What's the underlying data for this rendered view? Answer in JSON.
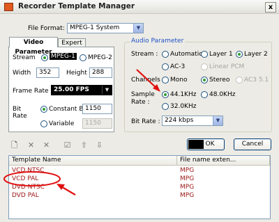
{
  "window": {
    "title": "Recorder Template Manager",
    "close_glyph": "x"
  },
  "file_format": {
    "label": "File Format:",
    "value": "MPEG-1 System"
  },
  "video": {
    "tabs": [
      "Video Parameter",
      "Expert"
    ],
    "stream_label": "Stream",
    "stream_options": [
      "MPEG-1",
      "MPEG-2"
    ],
    "stream_selected": "MPEG-1",
    "width_label": "Width",
    "width_value": "352",
    "height_label": "Height",
    "height_value": "288",
    "frame_rate_label": "Frame Rate",
    "frame_rate_value": "25.00 FPS",
    "bit_rate_label": "Bit Rate",
    "constant_label": "Constant B",
    "constant_value": "1150",
    "variable_label": "Variable",
    "variable_value": "1150"
  },
  "audio": {
    "group_title": "Audio Parameter",
    "stream_label": "Stream :",
    "stream_options": [
      "Automatic",
      "Layer 1",
      "Layer 2",
      "AC-3",
      "Linear PCM"
    ],
    "stream_selected": "Layer 2",
    "channels_label": "Channels :",
    "channel_options": [
      "Mono",
      "Stereo",
      "AC3 5.1"
    ],
    "channel_selected": "Stereo",
    "sample_rate_label_1": "Sample",
    "sample_rate_label_2": "Rate :",
    "sample_options": [
      "44.1KHz",
      "48.0KHz",
      "32.0KHz"
    ],
    "sample_selected": "44.1KHz",
    "bit_rate_label": "Bit Rate :",
    "bit_rate_value": "224 kbps"
  },
  "buttons": {
    "ok": "OK",
    "cancel": "Cancel"
  },
  "toolbar": [
    "new-template-icon",
    "delete-icon",
    "delete-all-icon",
    "apply-icon",
    "move-up-icon",
    "move-down-icon"
  ],
  "table": {
    "columns": [
      "Template Name",
      "File name exten..."
    ],
    "rows": [
      {
        "name": "VCD NTSC",
        "ext": "MPG"
      },
      {
        "name": "VCD PAL",
        "ext": "MPG"
      },
      {
        "name": "DVD NTSC",
        "ext": "MPG"
      },
      {
        "name": "DVD PAL",
        "ext": "MPG"
      }
    ]
  },
  "colors": {
    "annotation": "#e01010",
    "row_text": "#9b1515",
    "xp_border": "#7f9db9"
  }
}
